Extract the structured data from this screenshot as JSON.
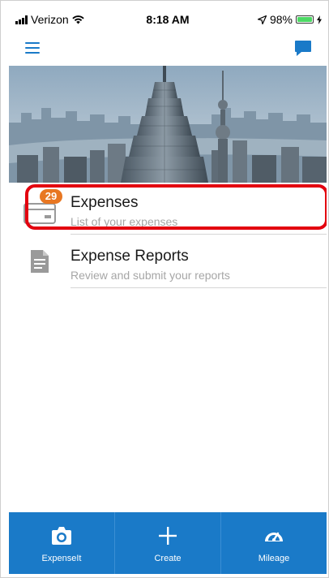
{
  "status_bar": {
    "carrier": "Verizon",
    "time": "8:18 AM",
    "battery": "98%",
    "battery_level": 0.98
  },
  "menu": {
    "items": [
      {
        "title": "Expenses",
        "subtitle": "List of your expenses",
        "badge": "29",
        "icon": "card-icon"
      },
      {
        "title": "Expense Reports",
        "subtitle": "Review and submit your reports",
        "icon": "document-icon"
      }
    ]
  },
  "tab_bar": {
    "tabs": [
      {
        "label": "ExpenseIt",
        "icon": "camera-icon"
      },
      {
        "label": "Create",
        "icon": "plus-icon"
      },
      {
        "label": "Mileage",
        "icon": "speedometer-icon"
      }
    ]
  },
  "colors": {
    "accent": "#1a7ac8",
    "badge": "#e87722",
    "highlight": "#e3000f"
  }
}
